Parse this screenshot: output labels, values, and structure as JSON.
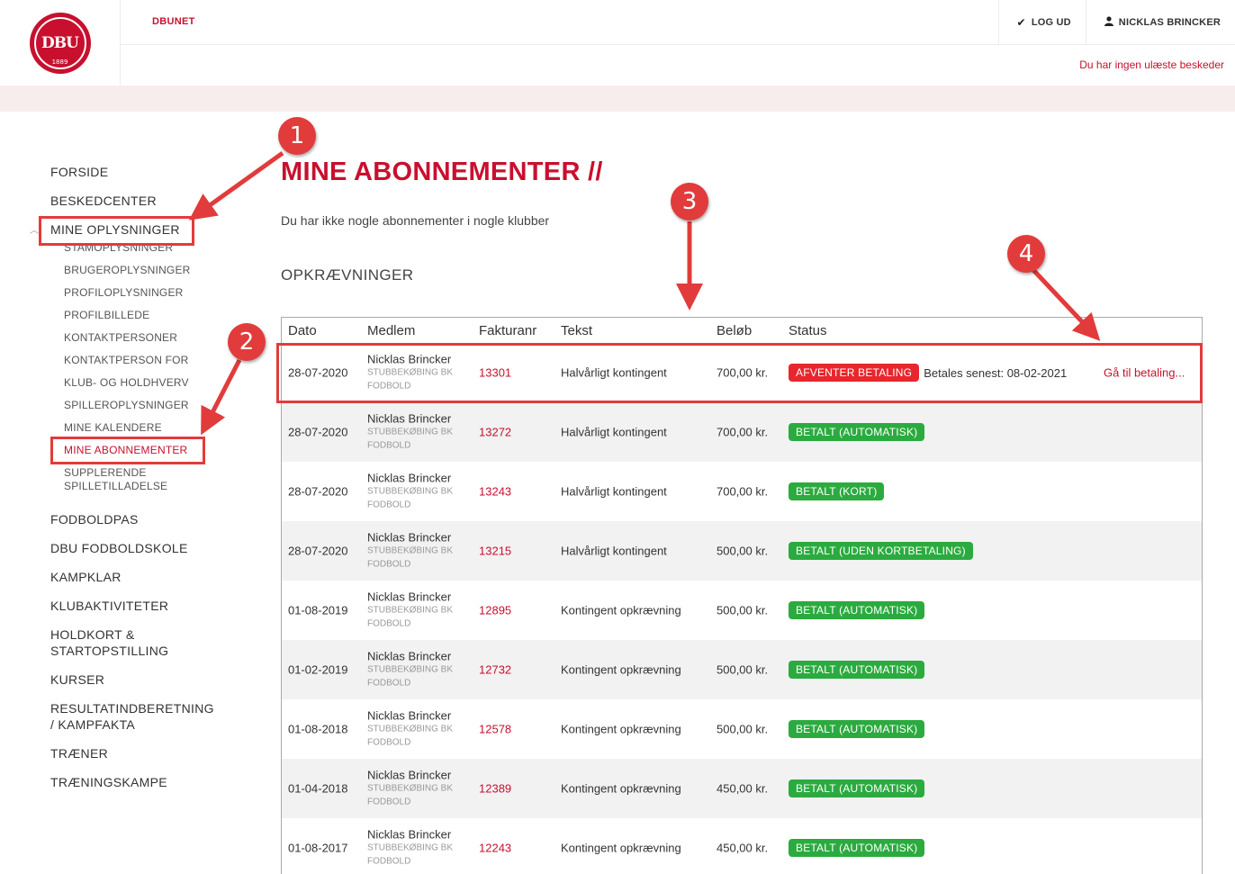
{
  "header": {
    "logo_text": "DBU",
    "logo_year": "1889",
    "brand": "DBUNET",
    "logout_label": "LOG UD",
    "user_name": "NICKLAS BRINCKER",
    "messages": "Du har ingen ulæste beskeder"
  },
  "sidebar": {
    "items": {
      "forside": "FORSIDE",
      "beskedcenter": "BESKEDCENTER",
      "mine_oplysninger": "MINE OPLYSNINGER",
      "fodboldpas": "FODBOLDPAS",
      "fodboldskole": "DBU FODBOLDSKOLE",
      "kampklar": "KAMPKLAR",
      "klubaktiviteter": "KLUBAKTIVITETER",
      "holdkort_1": "HOLDKORT &",
      "holdkort_2": "STARTOPSTILLING",
      "kurser": "KURSER",
      "resultat_1": "RESULTATINDBERETNING",
      "resultat_2": "/ KAMPFAKTA",
      "traener": "TRÆNER",
      "traeningskampe": "TRÆNINGSKAMPE"
    },
    "sub": {
      "stamoplysninger": "STAMOPLYSNINGER",
      "brugeroplysninger": "BRUGEROPLYSNINGER",
      "profiloplysninger": "PROFILOPLYSNINGER",
      "profilbillede": "PROFILBILLEDE",
      "kontaktpersoner": "KONTAKTPERSONER",
      "kontaktperson_for": "KONTAKTPERSON FOR",
      "klub_holdhverv": "KLUB- OG HOLDHVERV",
      "spilleroplysninger": "SPILLEROPLYSNINGER",
      "mine_kalendere": "MINE KALENDERE",
      "mine_abonnementer": "MINE ABONNEMENTER",
      "supplerende_1": "SUPPLERENDE",
      "supplerende_2": "SPILLETILLADELSE"
    }
  },
  "main": {
    "title": "MINE ABONNEMENTER //",
    "no_subscriptions": "Du har ikke nogle abonnementer i nogle klubber",
    "section_title": "OPKRÆVNINGER"
  },
  "table": {
    "headers": {
      "date": "Dato",
      "member": "Medlem",
      "invoice": "Fakturanr",
      "text": "Tekst",
      "amount": "Beløb",
      "status": "Status"
    },
    "rows": [
      {
        "date": "28-07-2020",
        "name": "Nicklas Brincker",
        "club1": "STUBBEKØBING BK",
        "club2": "FODBOLD",
        "invoice": "13301",
        "text": "Halvårligt kontingent",
        "amount": "700,00 kr.",
        "status": "AFVENTER BETALING",
        "deadline": "Betales senest: 08-02-2021",
        "pay": "Gå til betaling..."
      },
      {
        "date": "28-07-2020",
        "name": "Nicklas Brincker",
        "club1": "STUBBEKØBING BK",
        "club2": "FODBOLD",
        "invoice": "13272",
        "text": "Halvårligt kontingent",
        "amount": "700,00 kr.",
        "status": "BETALT (AUTOMATISK)"
      },
      {
        "date": "28-07-2020",
        "name": "Nicklas Brincker",
        "club1": "STUBBEKØBING BK",
        "club2": "FODBOLD",
        "invoice": "13243",
        "text": "Halvårligt kontingent",
        "amount": "700,00 kr.",
        "status": "BETALT (KORT)"
      },
      {
        "date": "28-07-2020",
        "name": "Nicklas Brincker",
        "club1": "STUBBEKØBING BK",
        "club2": "FODBOLD",
        "invoice": "13215",
        "text": "Halvårligt kontingent",
        "amount": "500,00 kr.",
        "status": "BETALT (UDEN KORTBETALING)"
      },
      {
        "date": "01-08-2019",
        "name": "Nicklas Brincker",
        "club1": "STUBBEKØBING BK",
        "club2": "FODBOLD",
        "invoice": "12895",
        "text": "Kontingent opkrævning",
        "amount": "500,00 kr.",
        "status": "BETALT (AUTOMATISK)"
      },
      {
        "date": "01-02-2019",
        "name": "Nicklas Brincker",
        "club1": "STUBBEKØBING BK",
        "club2": "FODBOLD",
        "invoice": "12732",
        "text": "Kontingent opkrævning",
        "amount": "500,00 kr.",
        "status": "BETALT (AUTOMATISK)"
      },
      {
        "date": "01-08-2018",
        "name": "Nicklas Brincker",
        "club1": "STUBBEKØBING BK",
        "club2": "FODBOLD",
        "invoice": "12578",
        "text": "Kontingent opkrævning",
        "amount": "500,00 kr.",
        "status": "BETALT (AUTOMATISK)"
      },
      {
        "date": "01-04-2018",
        "name": "Nicklas Brincker",
        "club1": "STUBBEKØBING BK",
        "club2": "FODBOLD",
        "invoice": "12389",
        "text": "Kontingent opkrævning",
        "amount": "450,00 kr.",
        "status": "BETALT (AUTOMATISK)"
      },
      {
        "date": "01-08-2017",
        "name": "Nicklas Brincker",
        "club1": "STUBBEKØBING BK",
        "club2": "FODBOLD",
        "invoice": "12243",
        "text": "Kontingent opkrævning",
        "amount": "450,00 kr.",
        "status": "BETALT (AUTOMATISK)"
      }
    ]
  },
  "annotations": {
    "badge_1": "1",
    "badge_2": "2",
    "badge_3": "3",
    "badge_4": "4",
    "color": "#e23b3b"
  },
  "colors": {
    "brand_red": "#c8102e",
    "status_red": "#e8262d",
    "status_green": "#2bab3f"
  }
}
